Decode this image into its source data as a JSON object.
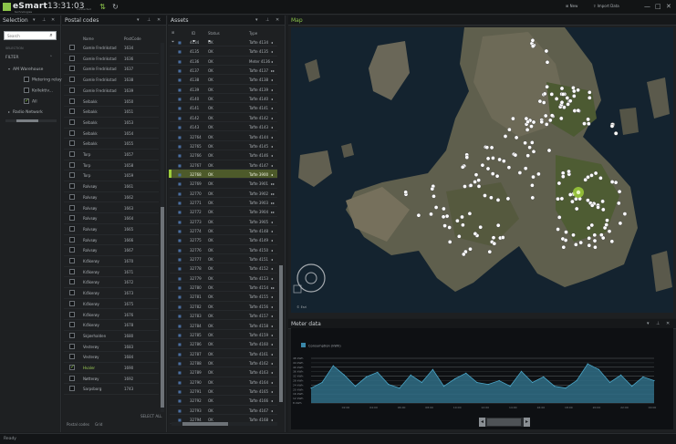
{
  "app": {
    "name": "eSmart",
    "subtitle": "technologies",
    "clock": "13:31:03",
    "clock_sub": "connected",
    "buttons": {
      "new": "New",
      "import": "Import Data"
    },
    "window": {
      "minimize": "—",
      "restore": "□",
      "close": "✕"
    }
  },
  "selection_panel": {
    "title": "Selection",
    "search_placeholder": "Search",
    "filter_label": "SELECTION",
    "tree": [
      {
        "label": "FILTER",
        "level": 0,
        "caret": "expanded"
      },
      {
        "label": "AM Warehouse",
        "level": 1,
        "caret": "expanded"
      },
      {
        "label": "Metering relay",
        "level": 2,
        "checkbox": false
      },
      {
        "label": "Kollektiv...",
        "level": 2,
        "checkbox": false
      },
      {
        "label": "All",
        "level": 2,
        "checkbox": true
      },
      {
        "label": "Radio Network",
        "level": 0,
        "caret": "collapsed"
      }
    ]
  },
  "postal_panel": {
    "title": "Postal codes",
    "columns": {
      "name": "Name",
      "code": "PostCode"
    },
    "rows": [
      {
        "name": "Gamle Fredrikstad",
        "code": "1634",
        "checked": false
      },
      {
        "name": "Gamle Fredrikstad",
        "code": "1636",
        "checked": false
      },
      {
        "name": "Gamle Fredrikstad",
        "code": "1637",
        "checked": false
      },
      {
        "name": "Gamle Fredrikstad",
        "code": "1638",
        "checked": false
      },
      {
        "name": "Gamle Fredrikstad",
        "code": "1639",
        "checked": false
      },
      {
        "name": "Selbakk",
        "code": "1650",
        "checked": false
      },
      {
        "name": "Selbakk",
        "code": "1651",
        "checked": false
      },
      {
        "name": "Selbakk",
        "code": "1653",
        "checked": false
      },
      {
        "name": "Selbakk",
        "code": "1654",
        "checked": false
      },
      {
        "name": "Selbakk",
        "code": "1655",
        "checked": false
      },
      {
        "name": "Torp",
        "code": "1657",
        "checked": false
      },
      {
        "name": "Torp",
        "code": "1658",
        "checked": false
      },
      {
        "name": "Torp",
        "code": "1659",
        "checked": false
      },
      {
        "name": "Rolvsøy",
        "code": "1661",
        "checked": false
      },
      {
        "name": "Rolvsøy",
        "code": "1662",
        "checked": false
      },
      {
        "name": "Rolvsøy",
        "code": "1663",
        "checked": false
      },
      {
        "name": "Rolvsøy",
        "code": "1664",
        "checked": false
      },
      {
        "name": "Rolvsøy",
        "code": "1665",
        "checked": false
      },
      {
        "name": "Rolvsøy",
        "code": "1666",
        "checked": false
      },
      {
        "name": "Rolvsøy",
        "code": "1667",
        "checked": false
      },
      {
        "name": "Kråkerøy",
        "code": "1670",
        "checked": false
      },
      {
        "name": "Kråkerøy",
        "code": "1671",
        "checked": false
      },
      {
        "name": "Kråkerøy",
        "code": "1672",
        "checked": false
      },
      {
        "name": "Kråkerøy",
        "code": "1673",
        "checked": false
      },
      {
        "name": "Kråkerøy",
        "code": "1675",
        "checked": false
      },
      {
        "name": "Kråkerøy",
        "code": "1676",
        "checked": false
      },
      {
        "name": "Kråkerøy",
        "code": "1678",
        "checked": false
      },
      {
        "name": "Skjærhalden",
        "code": "1680",
        "checked": false
      },
      {
        "name": "Vesterøy",
        "code": "1683",
        "checked": false
      },
      {
        "name": "Vesterøy",
        "code": "1684",
        "checked": false
      },
      {
        "name": "Hvaler",
        "code": "1690",
        "checked": true
      },
      {
        "name": "Nøtterøy",
        "code": "1692",
        "checked": false
      },
      {
        "name": "Sarpsborg",
        "code": "1743",
        "checked": false
      }
    ],
    "tabs": [
      "Postal codes",
      "Grid"
    ],
    "select_all": "SELECT ALL"
  },
  "assets_panel": {
    "title": "Assets",
    "columns": {
      "id": "ID",
      "status": "Status",
      "type": "Type"
    },
    "rows": [
      {
        "id": "4134",
        "status": "OK",
        "type": "Tafte 4134",
        "icon": "◂"
      },
      {
        "id": "4135",
        "status": "OK",
        "type": "Tafte 4135",
        "icon": "◂"
      },
      {
        "id": "4136",
        "status": "OK",
        "type": "Meter 4136",
        "icon": "◂"
      },
      {
        "id": "4137",
        "status": "OK",
        "type": "Tafte 4137",
        "icon": "▸▸"
      },
      {
        "id": "4138",
        "status": "OK",
        "type": "Tafte 4138",
        "icon": "◂"
      },
      {
        "id": "4139",
        "status": "OK",
        "type": "Tafte 4139",
        "icon": "◂"
      },
      {
        "id": "4140",
        "status": "OK",
        "type": "Tafte 4140",
        "icon": "◂"
      },
      {
        "id": "4141",
        "status": "OK",
        "type": "Tafte 4141",
        "icon": "◂"
      },
      {
        "id": "4142",
        "status": "OK",
        "type": "Tafte 4142",
        "icon": "◂"
      },
      {
        "id": "4143",
        "status": "OK",
        "type": "Tafte 4143",
        "icon": "◂"
      },
      {
        "id": "32764",
        "status": "OK",
        "type": "Tafte 4144",
        "icon": "◂"
      },
      {
        "id": "32765",
        "status": "OK",
        "type": "Tafte 4145",
        "icon": "◂"
      },
      {
        "id": "32766",
        "status": "OK",
        "type": "Tafte 4146",
        "icon": "◂"
      },
      {
        "id": "32767",
        "status": "OK",
        "type": "Tafte 4147",
        "icon": "◂"
      },
      {
        "id": "32768",
        "status": "OK",
        "type": "Tafte 3900",
        "icon": "◂"
      },
      {
        "id": "32769",
        "status": "OK",
        "type": "Tafte 3901",
        "icon": "▸▸"
      },
      {
        "id": "32770",
        "status": "OK",
        "type": "Tafte 3902",
        "icon": "▸▸"
      },
      {
        "id": "32771",
        "status": "OK",
        "type": "Tafte 3903",
        "icon": "▸▸"
      },
      {
        "id": "32772",
        "status": "OK",
        "type": "Tafte 3904",
        "icon": "▸▸"
      },
      {
        "id": "32773",
        "status": "OK",
        "type": "Tafte 3905",
        "icon": "◂"
      },
      {
        "id": "32774",
        "status": "OK",
        "type": "Tafte 4148",
        "icon": "◂"
      },
      {
        "id": "32775",
        "status": "OK",
        "type": "Tafte 4149",
        "icon": "◂"
      },
      {
        "id": "32776",
        "status": "OK",
        "type": "Tafte 4150",
        "icon": "◂"
      },
      {
        "id": "32777",
        "status": "OK",
        "type": "Tafte 4151",
        "icon": "◂"
      },
      {
        "id": "32778",
        "status": "OK",
        "type": "Tafte 4152",
        "icon": "◂"
      },
      {
        "id": "32779",
        "status": "OK",
        "type": "Tafte 4153",
        "icon": "◂"
      },
      {
        "id": "32780",
        "status": "OK",
        "type": "Tafte 4154",
        "icon": "▸▸"
      },
      {
        "id": "32781",
        "status": "OK",
        "type": "Tafte 4155",
        "icon": "◂"
      },
      {
        "id": "32782",
        "status": "OK",
        "type": "Tafte 4156",
        "icon": "◂"
      },
      {
        "id": "32783",
        "status": "OK",
        "type": "Tafte 4157",
        "icon": "◂"
      },
      {
        "id": "32784",
        "status": "OK",
        "type": "Tafte 4158",
        "icon": "◂"
      },
      {
        "id": "32785",
        "status": "OK",
        "type": "Tafte 4159",
        "icon": "◂"
      },
      {
        "id": "32786",
        "status": "OK",
        "type": "Tafte 4160",
        "icon": "◂"
      },
      {
        "id": "32787",
        "status": "OK",
        "type": "Tafte 4161",
        "icon": "◂"
      },
      {
        "id": "32788",
        "status": "OK",
        "type": "Tafte 4162",
        "icon": "◂"
      },
      {
        "id": "32789",
        "status": "OK",
        "type": "Tafte 4163",
        "icon": "◂"
      },
      {
        "id": "32790",
        "status": "OK",
        "type": "Tafte 4164",
        "icon": "◂"
      },
      {
        "id": "32791",
        "status": "OK",
        "type": "Tafte 4165",
        "icon": "◂"
      },
      {
        "id": "32792",
        "status": "OK",
        "type": "Tafte 4166",
        "icon": "◂"
      },
      {
        "id": "32793",
        "status": "OK",
        "type": "Tafte 4167",
        "icon": "◂"
      },
      {
        "id": "32794",
        "status": "OK",
        "type": "Tafte 4168",
        "icon": "◂"
      }
    ],
    "selected_row": 14
  },
  "map_panel": {
    "title": "Map",
    "attribution": "© Esri",
    "controls": {
      "zoom_in": "+",
      "zoom_out": "−",
      "pan": "✥"
    }
  },
  "meter_panel": {
    "title": "Meter data",
    "legend": "Consumption (kWh)",
    "scroll_left": "◂",
    "scroll_right": "▸"
  },
  "chart_data": {
    "type": "area",
    "title": "",
    "xlabel": "",
    "ylabel": "",
    "series": [
      {
        "name": "Consumption (kWh)",
        "values": [
          16,
          22,
          40,
          30,
          18,
          28,
          33,
          20,
          16,
          30,
          22,
          36,
          18,
          26,
          32,
          22,
          20,
          24,
          18,
          34,
          22,
          28,
          18,
          16,
          24,
          42,
          36,
          22,
          30,
          18,
          28,
          24
        ]
      }
    ],
    "ylim": [
      0,
      48
    ],
    "y_ticks": [
      "48 kWh",
      "44 kWh",
      "40 kWh",
      "36 kWh",
      "32 kWh",
      "28 kWh",
      "24 kWh",
      "20 kWh",
      "16 kWh",
      "12 kWh",
      "8 kWh"
    ],
    "x_ticks": [
      "02:00",
      "04:00",
      "06:00",
      "08:00",
      "10:00",
      "12:00",
      "14:00",
      "16:00",
      "18:00",
      "20:00",
      "22:00",
      "00:00"
    ],
    "colors": {
      "line": "#4aa6c8",
      "fill": "#2f6d86"
    }
  },
  "status": {
    "text": "Ready"
  },
  "colors": {
    "accent": "#8bc34a",
    "selected_row": "#4d5a2a",
    "map_pin": "#ffffff"
  }
}
